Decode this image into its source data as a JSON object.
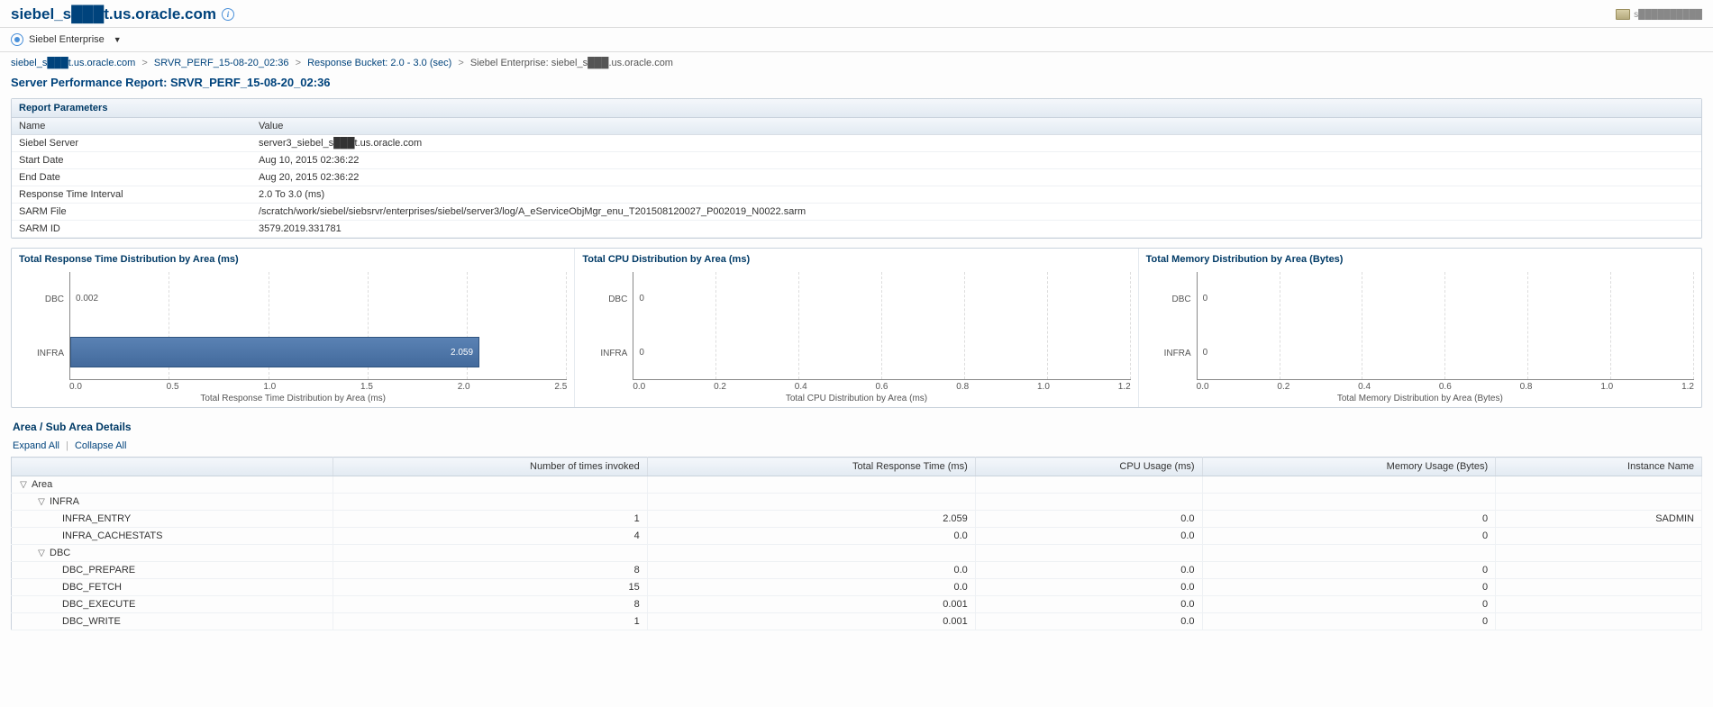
{
  "header": {
    "title": "siebel_s███t.us.oracle.com",
    "right_status": "s██████████"
  },
  "enterprise": {
    "label": "Siebel Enterprise"
  },
  "breadcrumb": {
    "items": [
      {
        "text": "siebel_s███t.us.oracle.com",
        "link": true
      },
      {
        "text": "SRVR_PERF_15-08-20_02:36",
        "link": true
      },
      {
        "text": "Response Bucket: 2.0 - 3.0 (sec)",
        "link": true
      },
      {
        "text": "Siebel Enterprise: siebel_s███.us.oracle.com",
        "link": false
      }
    ]
  },
  "report_title": "Server Performance Report: SRVR_PERF_15-08-20_02:36",
  "params": {
    "heading": "Report Parameters",
    "col_name": "Name",
    "col_value": "Value",
    "rows": [
      {
        "name": "Siebel Server",
        "value": "server3_siebel_s███t.us.oracle.com"
      },
      {
        "name": "Start Date",
        "value": "Aug 10, 2015 02:36:22"
      },
      {
        "name": "End Date",
        "value": "Aug 20, 2015 02:36:22"
      },
      {
        "name": "Response Time Interval",
        "value": "2.0 To 3.0 (ms)"
      },
      {
        "name": "SARM File",
        "value": "/scratch/work/siebel/siebsrvr/enterprises/siebel/server3/log/A_eServiceObjMgr_enu_T201508120027_P002019_N0022.sarm"
      },
      {
        "name": "SARM ID",
        "value": "3579.2019.331781"
      }
    ]
  },
  "chart_data": [
    {
      "type": "bar",
      "orientation": "horizontal",
      "title": "Total Response Time Distribution by Area (ms)",
      "xlabel": "Total Response Time Distribution by Area (ms)",
      "categories": [
        "DBC",
        "INFRA"
      ],
      "values": [
        0.002,
        2.059
      ],
      "xlim": [
        0.0,
        2.5
      ],
      "xticks": [
        0.0,
        0.5,
        1.0,
        1.5,
        2.0,
        2.5
      ]
    },
    {
      "type": "bar",
      "orientation": "horizontal",
      "title": "Total CPU Distribution by Area (ms)",
      "xlabel": "Total CPU Distribution by Area (ms)",
      "categories": [
        "DBC",
        "INFRA"
      ],
      "values": [
        0,
        0
      ],
      "xlim": [
        0.0,
        1.2
      ],
      "xticks": [
        0.0,
        0.2,
        0.4,
        0.6,
        0.8,
        1.0,
        1.2
      ]
    },
    {
      "type": "bar",
      "orientation": "horizontal",
      "title": "Total Memory Distribution by Area (Bytes)",
      "xlabel": "Total Memory Distribution by Area (Bytes)",
      "categories": [
        "DBC",
        "INFRA"
      ],
      "values": [
        0,
        0
      ],
      "xlim": [
        0.0,
        1.2
      ],
      "xticks": [
        0.0,
        0.2,
        0.4,
        0.6,
        0.8,
        1.0,
        1.2
      ]
    }
  ],
  "details": {
    "heading": "Area / Sub Area Details",
    "expand": "Expand All",
    "collapse": "Collapse All",
    "columns": [
      "",
      "Number of times invoked",
      "Total Response Time (ms)",
      "CPU Usage (ms)",
      "Memory Usage (Bytes)",
      "Instance Name"
    ],
    "root_label": "Area",
    "groups": [
      {
        "name": "INFRA",
        "rows": [
          {
            "name": "INFRA_ENTRY",
            "invoked": "1",
            "resp": "2.059",
            "cpu": "0.0",
            "mem": "0",
            "instance": "SADMIN"
          },
          {
            "name": "INFRA_CACHESTATS",
            "invoked": "4",
            "resp": "0.0",
            "cpu": "0.0",
            "mem": "0",
            "instance": ""
          }
        ]
      },
      {
        "name": "DBC",
        "rows": [
          {
            "name": "DBC_PREPARE",
            "invoked": "8",
            "resp": "0.0",
            "cpu": "0.0",
            "mem": "0",
            "instance": ""
          },
          {
            "name": "DBC_FETCH",
            "invoked": "15",
            "resp": "0.0",
            "cpu": "0.0",
            "mem": "0",
            "instance": ""
          },
          {
            "name": "DBC_EXECUTE",
            "invoked": "8",
            "resp": "0.001",
            "cpu": "0.0",
            "mem": "0",
            "instance": ""
          },
          {
            "name": "DBC_WRITE",
            "invoked": "1",
            "resp": "0.001",
            "cpu": "0.0",
            "mem": "0",
            "instance": ""
          }
        ]
      }
    ]
  }
}
